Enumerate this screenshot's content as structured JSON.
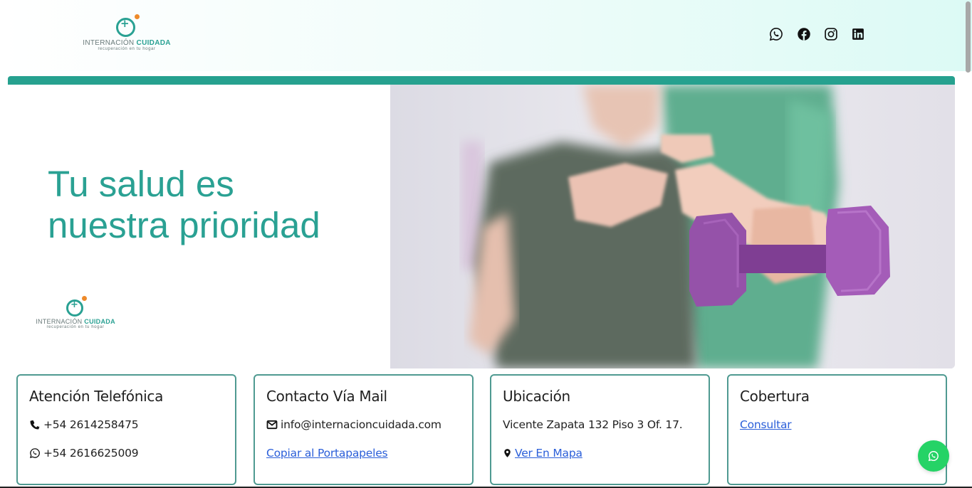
{
  "brand": {
    "name_first": "INTERNACIÓN",
    "name_second": "CUIDADA",
    "tagline": "recuperación en tu hogar",
    "colors": {
      "primary": "#2aa193",
      "accent": "#ee8a2a",
      "whatsapp": "#25d366",
      "link": "#2b5fd9"
    }
  },
  "header": {
    "social": [
      {
        "icon": "whatsapp-icon"
      },
      {
        "icon": "facebook-icon"
      },
      {
        "icon": "instagram-icon"
      },
      {
        "icon": "linkedin-icon"
      }
    ]
  },
  "hero": {
    "title_line1": "Tu salud es",
    "title_line2": "nuestra prioridad"
  },
  "cards": {
    "phone": {
      "title": "Atención Telefónica",
      "line1": "+54 2614258475",
      "line2": "+54 2616625009"
    },
    "mail": {
      "title": "Contacto Vía Mail",
      "email": "info@internacioncuidada.com",
      "copy_link": "Copiar al Portapapeles"
    },
    "location": {
      "title": "Ubicación",
      "address": "Vicente Zapata 132 Piso 3 Of. 17.",
      "map_link": "Ver En Mapa"
    },
    "coverage": {
      "title": "Cobertura",
      "link": "Consultar"
    }
  },
  "floating": {
    "icon": "whatsapp-icon"
  }
}
